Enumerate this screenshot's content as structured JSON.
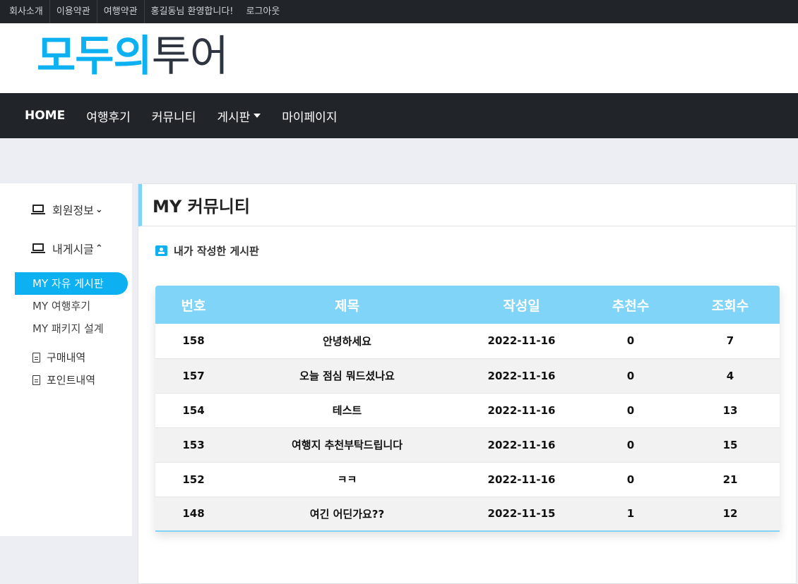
{
  "topbar": {
    "links": [
      "회사소개",
      "이용약관",
      "여행약관",
      "홍길동님 환영합니다!",
      "로그아웃"
    ]
  },
  "logo": {
    "highlight": "모두의",
    "rest": "투어"
  },
  "nav": {
    "items": [
      "HOME",
      "여행후기",
      "커뮤니티",
      "게시판",
      "마이페이지"
    ]
  },
  "sidebar": {
    "member_info": "회원정보",
    "my_posts": "내게시글",
    "sub_items": [
      "MY 자유 게시판",
      "MY 여행후기",
      "MY 패키지 설계"
    ],
    "purchase": "구매내역",
    "points": "포인트내역"
  },
  "main": {
    "title": "MY 커뮤니티",
    "section_label": "내가 작성한 게시판"
  },
  "table": {
    "headers": [
      "번호",
      "제목",
      "작성일",
      "추천수",
      "조회수"
    ],
    "rows": [
      [
        "158",
        "안녕하세요",
        "2022-11-16",
        "0",
        "7"
      ],
      [
        "157",
        "오늘 점심 뭐드셨나요",
        "2022-11-16",
        "0",
        "4"
      ],
      [
        "154",
        "테스트",
        "2022-11-16",
        "0",
        "13"
      ],
      [
        "153",
        "여행지 추천부탁드립니다",
        "2022-11-16",
        "0",
        "15"
      ],
      [
        "152",
        "ㅋㅋ",
        "2022-11-16",
        "0",
        "21"
      ],
      [
        "148",
        "여긴 어딘가요??",
        "2022-11-15",
        "1",
        "12"
      ]
    ]
  },
  "colors": {
    "accent": "#0db1f1",
    "table_header": "#7fd4f8",
    "dark_bar": "#212529",
    "page_bg": "#eceef3"
  }
}
